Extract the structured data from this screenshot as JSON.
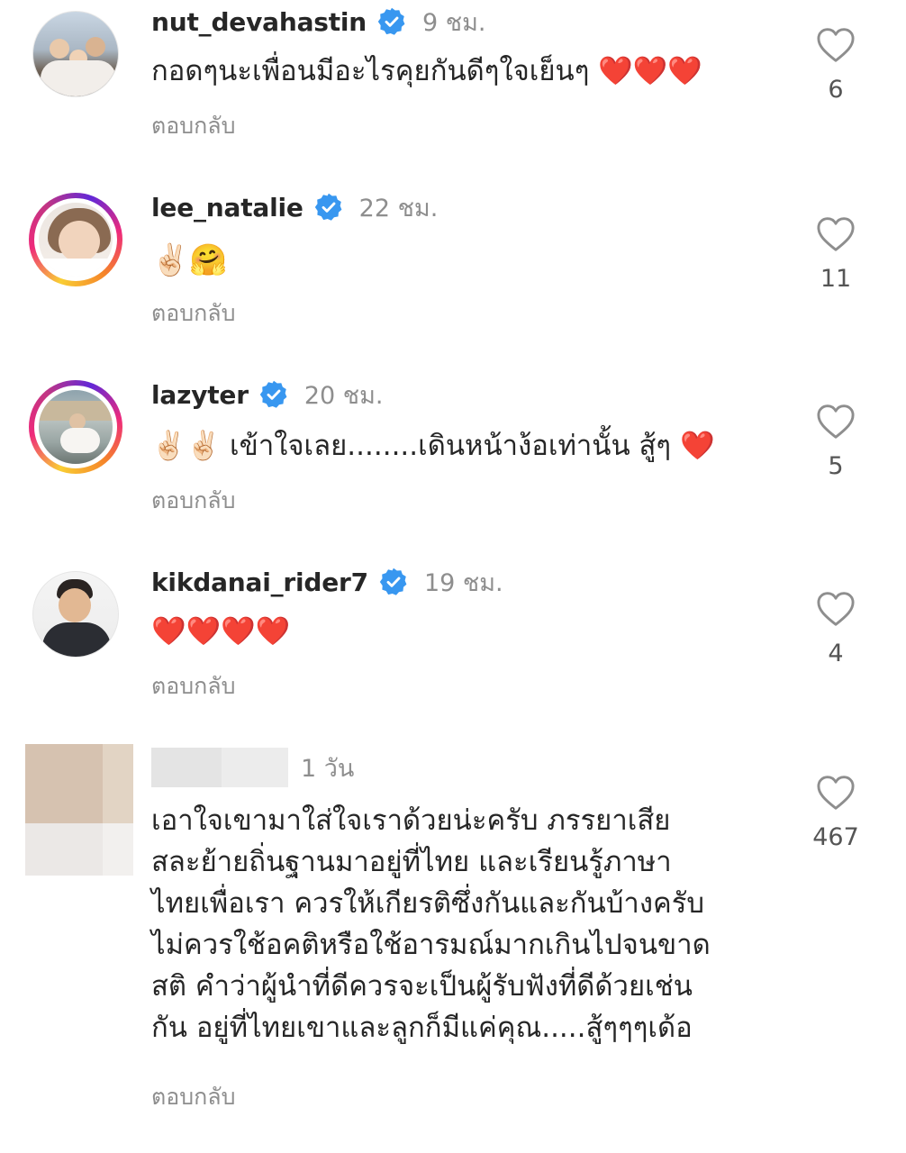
{
  "comments": [
    {
      "username": "nut_devahastin",
      "time": "9 ชม.",
      "text": "กอดๆนะเพื่อนมีอะไรคุยกันดีๆใจเย็นๆ ❤️❤️❤️",
      "reply_label": "ตอบกลับ",
      "likes": "6",
      "verified": true
    },
    {
      "username": "lee_natalie",
      "time": "22 ชม.",
      "text": "✌🏻🤗",
      "reply_label": "ตอบกลับ",
      "likes": "11",
      "verified": true
    },
    {
      "username": "lazyter",
      "time": "20 ชม.",
      "text": "✌🏻✌🏻 เข้าใจเลย........เดินหน้าง้อเท่านั้น สู้ๆ ❤️",
      "reply_label": "ตอบกลับ",
      "likes": "5",
      "verified": true
    },
    {
      "username": "kikdanai_rider7",
      "time": "19 ชม.",
      "text": "❤️❤️❤️❤️",
      "reply_label": "ตอบกลับ",
      "likes": "4",
      "verified": true
    },
    {
      "username": "",
      "time": "1 วัน",
      "text_lines": [
        "เอาใจเขามาใส่ใจเราด้วยน่ะครับ ภรรยาเสีย",
        "สละย้ายถิ่นฐานมาอยู่ที่ไทย และเรียนรู้ภาษา",
        "ไทยเพื่อเรา ควรให้เกียรติซึ่งกันและกันบ้างครับ",
        "ไม่ควรใช้อคติหรือใช้อารมณ์มากเกินไปจนขาด",
        "สติ คำว่าผู้นำที่ดีควรจะเป็นผู้รับฟังที่ดีด้วยเช่น",
        "กัน อยู่ที่ไทยเขาและลูกก็มีแค่คุณ.....สู้ๆๆๆเด้อ"
      ],
      "reply_label": "ตอบกลับ",
      "likes": "467",
      "verified": false
    }
  ],
  "colors": {
    "verified_blue": "#3897f0",
    "secondary_text": "#8e8e8e",
    "like_heart_outline": "#8e8e8e"
  },
  "icons": {
    "verified": "verified-badge-icon",
    "like": "heart-outline-icon"
  }
}
